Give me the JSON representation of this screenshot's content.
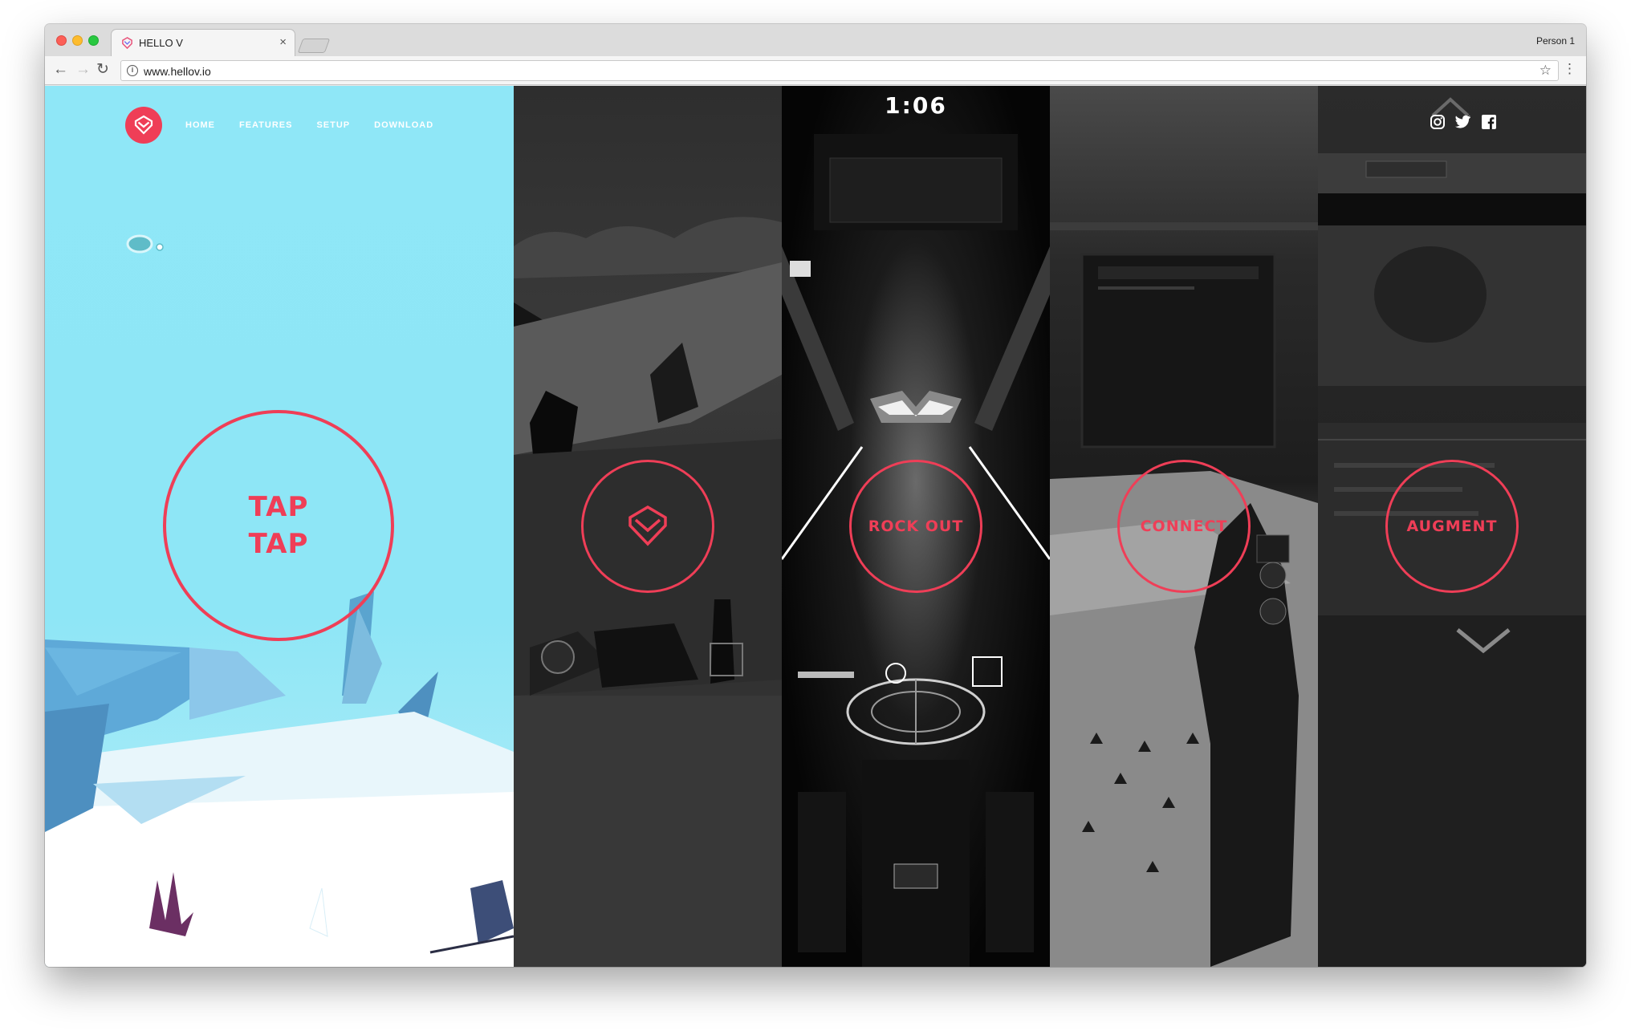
{
  "browser": {
    "tab_title": "HELLO V",
    "tab_close": "×",
    "profile": "Person 1",
    "url": "www.hellov.io",
    "info_glyph": "i",
    "back_glyph": "←",
    "forward_glyph": "→",
    "reload_glyph": "↻",
    "star_glyph": "☆",
    "menu_glyph": "⋮",
    "icons": {
      "favicon": "hellov-favicon-icon",
      "back": "back-arrow-icon",
      "forward": "forward-arrow-icon",
      "reload": "reload-icon",
      "info": "info-icon",
      "star": "bookmark-star-icon",
      "menu": "more-menu-icon"
    }
  },
  "site": {
    "logo": "hellov-logo-icon",
    "nav": {
      "home": "HOME",
      "features": "FEATURES",
      "setup": "SETUP",
      "download": "DOWNLOAD"
    },
    "hero": {
      "line1": "TAP",
      "line2": "TAP"
    },
    "clock": "1:06",
    "panels": {
      "rock_out": "ROCK OUT",
      "connect": "CONNECT",
      "augment": "AUGMENT"
    },
    "social": [
      "instagram-icon",
      "twitter-icon",
      "facebook-icon"
    ],
    "accent_color": "#ef3e57",
    "hero_bg_color": "#8fe7f7"
  }
}
